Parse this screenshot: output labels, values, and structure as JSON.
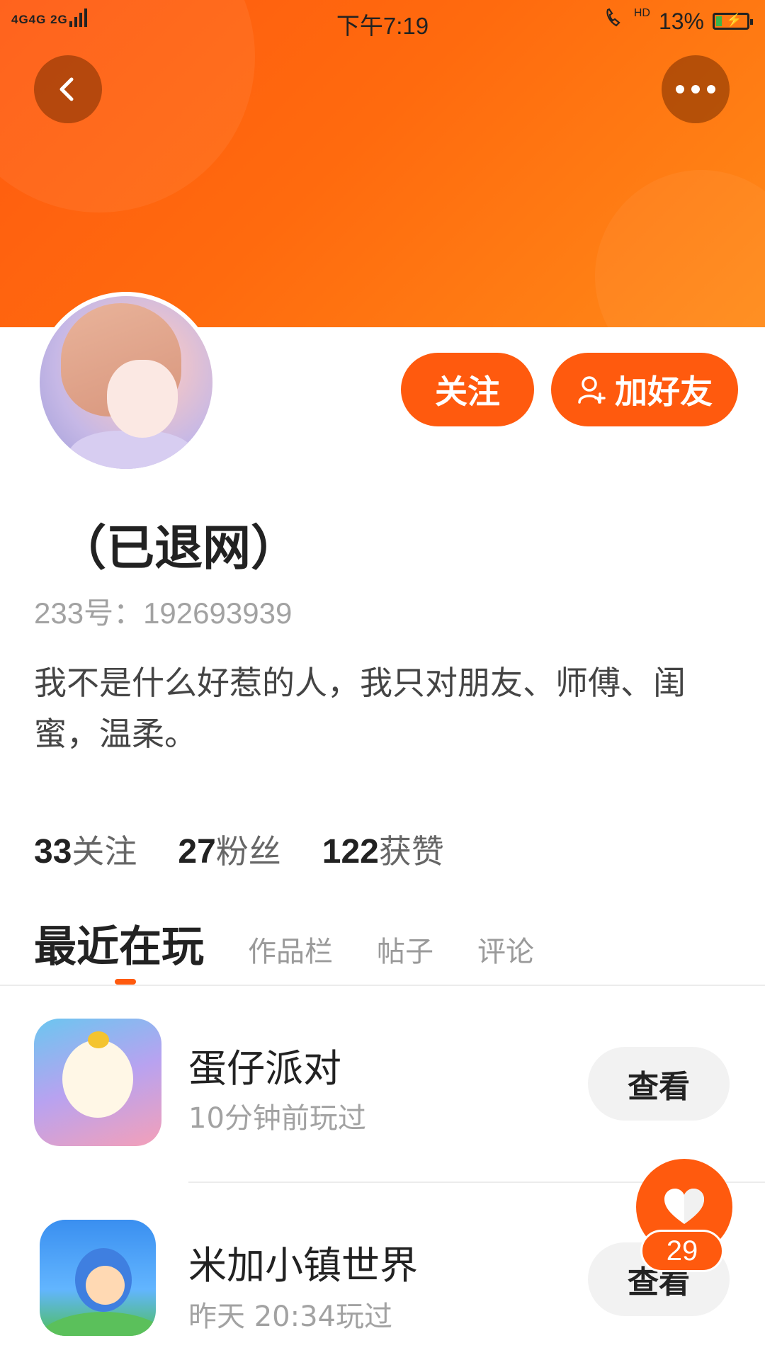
{
  "status_bar": {
    "signal_text": "4G4G 2G",
    "time": "下午7:19",
    "hd": "HD",
    "battery": "13%",
    "battery_level": 0.13
  },
  "header": {
    "back_icon": "chevron-left-icon",
    "more_icon": "more-dots-icon"
  },
  "profile": {
    "avatar": "avatar-anime-girl",
    "follow_label": "关注",
    "add_friend_label": "加好友",
    "nickname": "（已退网）",
    "uid": "233号：192693939",
    "bio": "我不是什么好惹的人，我只对朋友、师傅、闺蜜，温柔。"
  },
  "stats": [
    {
      "num": "33",
      "label": "关注"
    },
    {
      "num": "27",
      "label": "粉丝"
    },
    {
      "num": "122",
      "label": "获赞"
    }
  ],
  "tabs": [
    {
      "label": "最近在玩",
      "active": true
    },
    {
      "label": "作品栏",
      "active": false
    },
    {
      "label": "帖子",
      "active": false
    },
    {
      "label": "评论",
      "active": false
    }
  ],
  "games": [
    {
      "title": "蛋仔派对",
      "subtitle": "10分钟前玩过",
      "action": "查看"
    },
    {
      "title": "米加小镇世界",
      "subtitle": "昨天 20:34玩过",
      "action": "查看"
    }
  ],
  "like_fab": {
    "icon": "heart-icon",
    "count": "29"
  },
  "colors": {
    "accent": "#ff5a0e",
    "banner_end": "#ff8a18"
  }
}
